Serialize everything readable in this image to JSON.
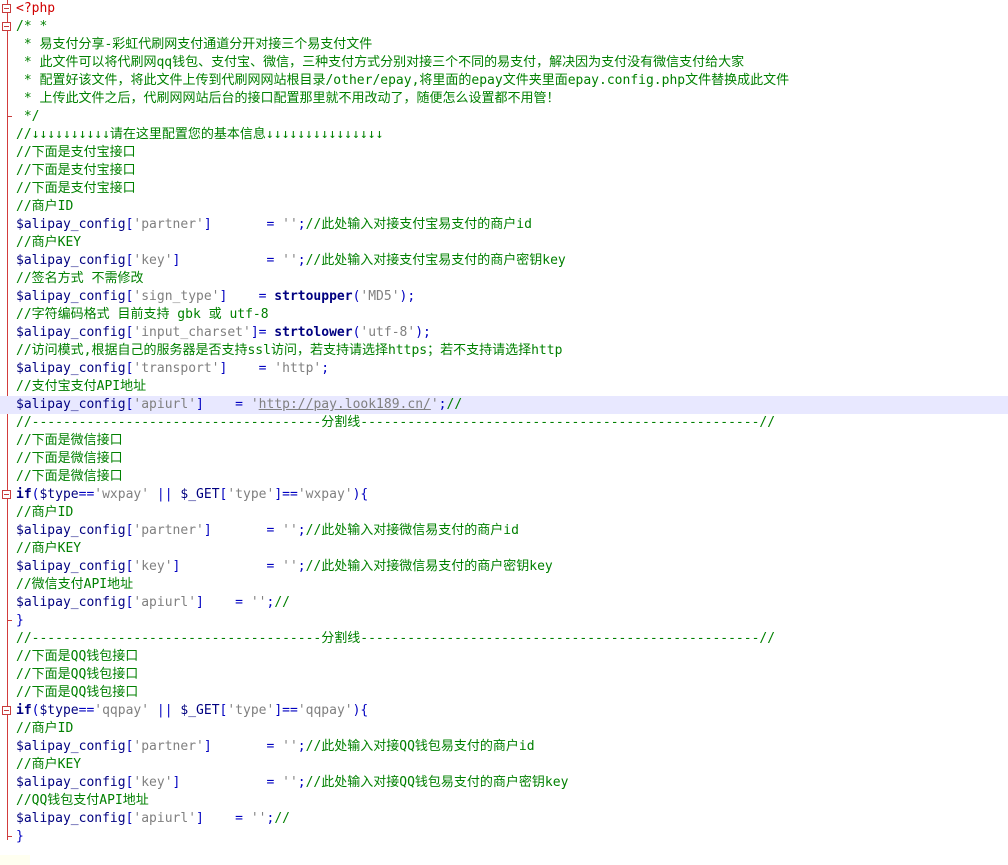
{
  "editor": {
    "language": "php",
    "colors": {
      "comment": "#008000",
      "variable": "#000080",
      "keyword": "#000080",
      "string": "#808080",
      "operator": "#0000c0",
      "php_tag": "#d00000",
      "fold_marker": "#c83c3c",
      "current_line": "#e8e8ff"
    },
    "current_line_index": 22,
    "lines": [
      {
        "marker": "fold",
        "tokens": [
          {
            "t": "php",
            "v": "<?php"
          }
        ]
      },
      {
        "marker": "fold",
        "tokens": [
          {
            "t": "comment",
            "v": "/* *"
          }
        ]
      },
      {
        "marker": "none",
        "tokens": [
          {
            "t": "comment",
            "v": " * 易支付分享-彩虹代刷网支付通道分开对接三个易支付文件"
          }
        ]
      },
      {
        "marker": "none",
        "tokens": [
          {
            "t": "comment",
            "v": " * 此文件可以将代刷网qq钱包、支付宝、微信，三种支付方式分别对接三个不同的易支付，解决因为支付没有微信支付给大家"
          }
        ]
      },
      {
        "marker": "none",
        "tokens": [
          {
            "t": "comment",
            "v": " * 配置好该文件，将此文件上传到代刷网网站根目录/other/epay,将里面的epay文件夹里面epay.config.php文件替换成此文件"
          }
        ]
      },
      {
        "marker": "none",
        "tokens": [
          {
            "t": "comment",
            "v": " * 上传此文件之后，代刷网网站后台的接口配置那里就不用改动了，随便怎么设置都不用管！"
          }
        ]
      },
      {
        "marker": "end",
        "tokens": [
          {
            "t": "comment",
            "v": " */"
          }
        ]
      },
      {
        "marker": "none",
        "tokens": [
          {
            "t": "comment",
            "v": "//↓↓↓↓↓↓↓↓↓↓请在这里配置您的基本信息↓↓↓↓↓↓↓↓↓↓↓↓↓↓↓"
          }
        ]
      },
      {
        "marker": "none",
        "tokens": [
          {
            "t": "comment",
            "v": "//下面是支付宝接口"
          }
        ]
      },
      {
        "marker": "none",
        "tokens": [
          {
            "t": "comment",
            "v": "//下面是支付宝接口"
          }
        ]
      },
      {
        "marker": "none",
        "tokens": [
          {
            "t": "comment",
            "v": "//下面是支付宝接口"
          }
        ]
      },
      {
        "marker": "none",
        "tokens": [
          {
            "t": "comment",
            "v": "//商户ID"
          }
        ]
      },
      {
        "marker": "none",
        "tokens": [
          {
            "t": "var",
            "v": "$alipay_config"
          },
          {
            "t": "op",
            "v": "["
          },
          {
            "t": "str",
            "v": "'partner'"
          },
          {
            "t": "op",
            "v": "]"
          },
          {
            "t": "plain",
            "v": "       "
          },
          {
            "t": "op",
            "v": "= "
          },
          {
            "t": "str",
            "v": "''"
          },
          {
            "t": "op",
            "v": ";"
          },
          {
            "t": "comment",
            "v": "//此处输入对接支付宝易支付的商户id"
          }
        ]
      },
      {
        "marker": "none",
        "tokens": [
          {
            "t": "comment",
            "v": "//商户KEY"
          }
        ]
      },
      {
        "marker": "none",
        "tokens": [
          {
            "t": "var",
            "v": "$alipay_config"
          },
          {
            "t": "op",
            "v": "["
          },
          {
            "t": "str",
            "v": "'key'"
          },
          {
            "t": "op",
            "v": "]"
          },
          {
            "t": "plain",
            "v": "           "
          },
          {
            "t": "op",
            "v": "= "
          },
          {
            "t": "str",
            "v": "''"
          },
          {
            "t": "op",
            "v": ";"
          },
          {
            "t": "comment",
            "v": "//此处输入对接支付宝易支付的商户密钥key"
          }
        ]
      },
      {
        "marker": "none",
        "tokens": [
          {
            "t": "comment",
            "v": "//签名方式 不需修改"
          }
        ]
      },
      {
        "marker": "none",
        "tokens": [
          {
            "t": "var",
            "v": "$alipay_config"
          },
          {
            "t": "op",
            "v": "["
          },
          {
            "t": "str",
            "v": "'sign_type'"
          },
          {
            "t": "op",
            "v": "]"
          },
          {
            "t": "plain",
            "v": "    "
          },
          {
            "t": "op",
            "v": "= "
          },
          {
            "t": "kw",
            "v": "strtoupper"
          },
          {
            "t": "op",
            "v": "("
          },
          {
            "t": "str",
            "v": "'MD5'"
          },
          {
            "t": "op",
            "v": ");"
          }
        ]
      },
      {
        "marker": "none",
        "tokens": [
          {
            "t": "comment",
            "v": "//字符编码格式 目前支持 gbk 或 utf-8"
          }
        ]
      },
      {
        "marker": "none",
        "tokens": [
          {
            "t": "var",
            "v": "$alipay_config"
          },
          {
            "t": "op",
            "v": "["
          },
          {
            "t": "str",
            "v": "'input_charset'"
          },
          {
            "t": "op",
            "v": "]= "
          },
          {
            "t": "kw",
            "v": "strtolower"
          },
          {
            "t": "op",
            "v": "("
          },
          {
            "t": "str",
            "v": "'utf-8'"
          },
          {
            "t": "op",
            "v": ");"
          }
        ]
      },
      {
        "marker": "none",
        "tokens": [
          {
            "t": "comment",
            "v": "//访问模式,根据自己的服务器是否支持ssl访问，若支持请选择https；若不支持请选择http"
          }
        ]
      },
      {
        "marker": "none",
        "tokens": [
          {
            "t": "var",
            "v": "$alipay_config"
          },
          {
            "t": "op",
            "v": "["
          },
          {
            "t": "str",
            "v": "'transport'"
          },
          {
            "t": "op",
            "v": "]"
          },
          {
            "t": "plain",
            "v": "    "
          },
          {
            "t": "op",
            "v": "= "
          },
          {
            "t": "str",
            "v": "'http'"
          },
          {
            "t": "op",
            "v": ";"
          }
        ]
      },
      {
        "marker": "none",
        "tokens": [
          {
            "t": "comment",
            "v": "//支付宝支付API地址"
          }
        ]
      },
      {
        "marker": "none",
        "tokens": [
          {
            "t": "var",
            "v": "$alipay_config"
          },
          {
            "t": "op",
            "v": "["
          },
          {
            "t": "str",
            "v": "'apiurl'"
          },
          {
            "t": "op",
            "v": "]"
          },
          {
            "t": "plain",
            "v": "    "
          },
          {
            "t": "op",
            "v": "= "
          },
          {
            "t": "str",
            "v": "'"
          },
          {
            "t": "link",
            "v": "http://pay.look189.cn/"
          },
          {
            "t": "str",
            "v": "'"
          },
          {
            "t": "op",
            "v": ";"
          },
          {
            "t": "comment",
            "v": "//"
          }
        ]
      },
      {
        "marker": "none",
        "tokens": [
          {
            "t": "comment",
            "v": "//-------------------------------------分割线---------------------------------------------------//"
          }
        ]
      },
      {
        "marker": "none",
        "tokens": [
          {
            "t": "comment",
            "v": "//下面是微信接口"
          }
        ]
      },
      {
        "marker": "none",
        "tokens": [
          {
            "t": "comment",
            "v": "//下面是微信接口"
          }
        ]
      },
      {
        "marker": "none",
        "tokens": [
          {
            "t": "comment",
            "v": "//下面是微信接口"
          }
        ]
      },
      {
        "marker": "fold",
        "tokens": [
          {
            "t": "kw",
            "v": "if"
          },
          {
            "t": "op",
            "v": "("
          },
          {
            "t": "var",
            "v": "$type"
          },
          {
            "t": "op",
            "v": "=="
          },
          {
            "t": "str",
            "v": "'wxpay'"
          },
          {
            "t": "plain",
            "v": " "
          },
          {
            "t": "op",
            "v": "||"
          },
          {
            "t": "plain",
            "v": " "
          },
          {
            "t": "var",
            "v": "$_GET"
          },
          {
            "t": "op",
            "v": "["
          },
          {
            "t": "str",
            "v": "'type'"
          },
          {
            "t": "op",
            "v": "]=="
          },
          {
            "t": "str",
            "v": "'wxpay'"
          },
          {
            "t": "op",
            "v": "){"
          }
        ]
      },
      {
        "marker": "none",
        "tokens": [
          {
            "t": "comment",
            "v": "//商户ID"
          }
        ]
      },
      {
        "marker": "none",
        "tokens": [
          {
            "t": "var",
            "v": "$alipay_config"
          },
          {
            "t": "op",
            "v": "["
          },
          {
            "t": "str",
            "v": "'partner'"
          },
          {
            "t": "op",
            "v": "]"
          },
          {
            "t": "plain",
            "v": "       "
          },
          {
            "t": "op",
            "v": "= "
          },
          {
            "t": "str",
            "v": "''"
          },
          {
            "t": "op",
            "v": ";"
          },
          {
            "t": "comment",
            "v": "//此处输入对接微信易支付的商户id"
          }
        ]
      },
      {
        "marker": "none",
        "tokens": [
          {
            "t": "comment",
            "v": "//商户KEY"
          }
        ]
      },
      {
        "marker": "none",
        "tokens": [
          {
            "t": "var",
            "v": "$alipay_config"
          },
          {
            "t": "op",
            "v": "["
          },
          {
            "t": "str",
            "v": "'key'"
          },
          {
            "t": "op",
            "v": "]"
          },
          {
            "t": "plain",
            "v": "           "
          },
          {
            "t": "op",
            "v": "= "
          },
          {
            "t": "str",
            "v": "''"
          },
          {
            "t": "op",
            "v": ";"
          },
          {
            "t": "comment",
            "v": "//此处输入对接微信易支付的商户密钥key"
          }
        ]
      },
      {
        "marker": "none",
        "tokens": [
          {
            "t": "comment",
            "v": "//微信支付API地址"
          }
        ]
      },
      {
        "marker": "none",
        "tokens": [
          {
            "t": "var",
            "v": "$alipay_config"
          },
          {
            "t": "op",
            "v": "["
          },
          {
            "t": "str",
            "v": "'apiurl'"
          },
          {
            "t": "op",
            "v": "]"
          },
          {
            "t": "plain",
            "v": "    "
          },
          {
            "t": "op",
            "v": "= "
          },
          {
            "t": "str",
            "v": "''"
          },
          {
            "t": "op",
            "v": ";"
          },
          {
            "t": "comment",
            "v": "//"
          }
        ]
      },
      {
        "marker": "end",
        "tokens": [
          {
            "t": "op",
            "v": "}"
          }
        ]
      },
      {
        "marker": "none",
        "tokens": [
          {
            "t": "comment",
            "v": "//-------------------------------------分割线---------------------------------------------------//"
          }
        ]
      },
      {
        "marker": "none",
        "tokens": [
          {
            "t": "comment",
            "v": "//下面是QQ钱包接口"
          }
        ]
      },
      {
        "marker": "none",
        "tokens": [
          {
            "t": "comment",
            "v": "//下面是QQ钱包接口"
          }
        ]
      },
      {
        "marker": "none",
        "tokens": [
          {
            "t": "comment",
            "v": "//下面是QQ钱包接口"
          }
        ]
      },
      {
        "marker": "fold",
        "tokens": [
          {
            "t": "kw",
            "v": "if"
          },
          {
            "t": "op",
            "v": "("
          },
          {
            "t": "var",
            "v": "$type"
          },
          {
            "t": "op",
            "v": "=="
          },
          {
            "t": "str",
            "v": "'qqpay'"
          },
          {
            "t": "plain",
            "v": " "
          },
          {
            "t": "op",
            "v": "||"
          },
          {
            "t": "plain",
            "v": " "
          },
          {
            "t": "var",
            "v": "$_GET"
          },
          {
            "t": "op",
            "v": "["
          },
          {
            "t": "str",
            "v": "'type'"
          },
          {
            "t": "op",
            "v": "]=="
          },
          {
            "t": "str",
            "v": "'qqpay'"
          },
          {
            "t": "op",
            "v": "){"
          }
        ]
      },
      {
        "marker": "none",
        "tokens": [
          {
            "t": "comment",
            "v": "//商户ID"
          }
        ]
      },
      {
        "marker": "none",
        "tokens": [
          {
            "t": "var",
            "v": "$alipay_config"
          },
          {
            "t": "op",
            "v": "["
          },
          {
            "t": "str",
            "v": "'partner'"
          },
          {
            "t": "op",
            "v": "]"
          },
          {
            "t": "plain",
            "v": "       "
          },
          {
            "t": "op",
            "v": "= "
          },
          {
            "t": "str",
            "v": "''"
          },
          {
            "t": "op",
            "v": ";"
          },
          {
            "t": "comment",
            "v": "//此处输入对接QQ钱包易支付的商户id"
          }
        ]
      },
      {
        "marker": "none",
        "tokens": [
          {
            "t": "comment",
            "v": "//商户KEY"
          }
        ]
      },
      {
        "marker": "none",
        "tokens": [
          {
            "t": "var",
            "v": "$alipay_config"
          },
          {
            "t": "op",
            "v": "["
          },
          {
            "t": "str",
            "v": "'key'"
          },
          {
            "t": "op",
            "v": "]"
          },
          {
            "t": "plain",
            "v": "           "
          },
          {
            "t": "op",
            "v": "= "
          },
          {
            "t": "str",
            "v": "''"
          },
          {
            "t": "op",
            "v": ";"
          },
          {
            "t": "comment",
            "v": "//此处输入对接QQ钱包易支付的商户密钥key"
          }
        ]
      },
      {
        "marker": "none",
        "tokens": [
          {
            "t": "comment",
            "v": "//QQ钱包支付API地址"
          }
        ]
      },
      {
        "marker": "none",
        "tokens": [
          {
            "t": "var",
            "v": "$alipay_config"
          },
          {
            "t": "op",
            "v": "["
          },
          {
            "t": "str",
            "v": "'apiurl'"
          },
          {
            "t": "op",
            "v": "]"
          },
          {
            "t": "plain",
            "v": "    "
          },
          {
            "t": "op",
            "v": "= "
          },
          {
            "t": "str",
            "v": "''"
          },
          {
            "t": "op",
            "v": ";"
          },
          {
            "t": "comment",
            "v": "//"
          }
        ]
      },
      {
        "marker": "end",
        "tokens": [
          {
            "t": "op",
            "v": "}"
          }
        ]
      }
    ]
  }
}
